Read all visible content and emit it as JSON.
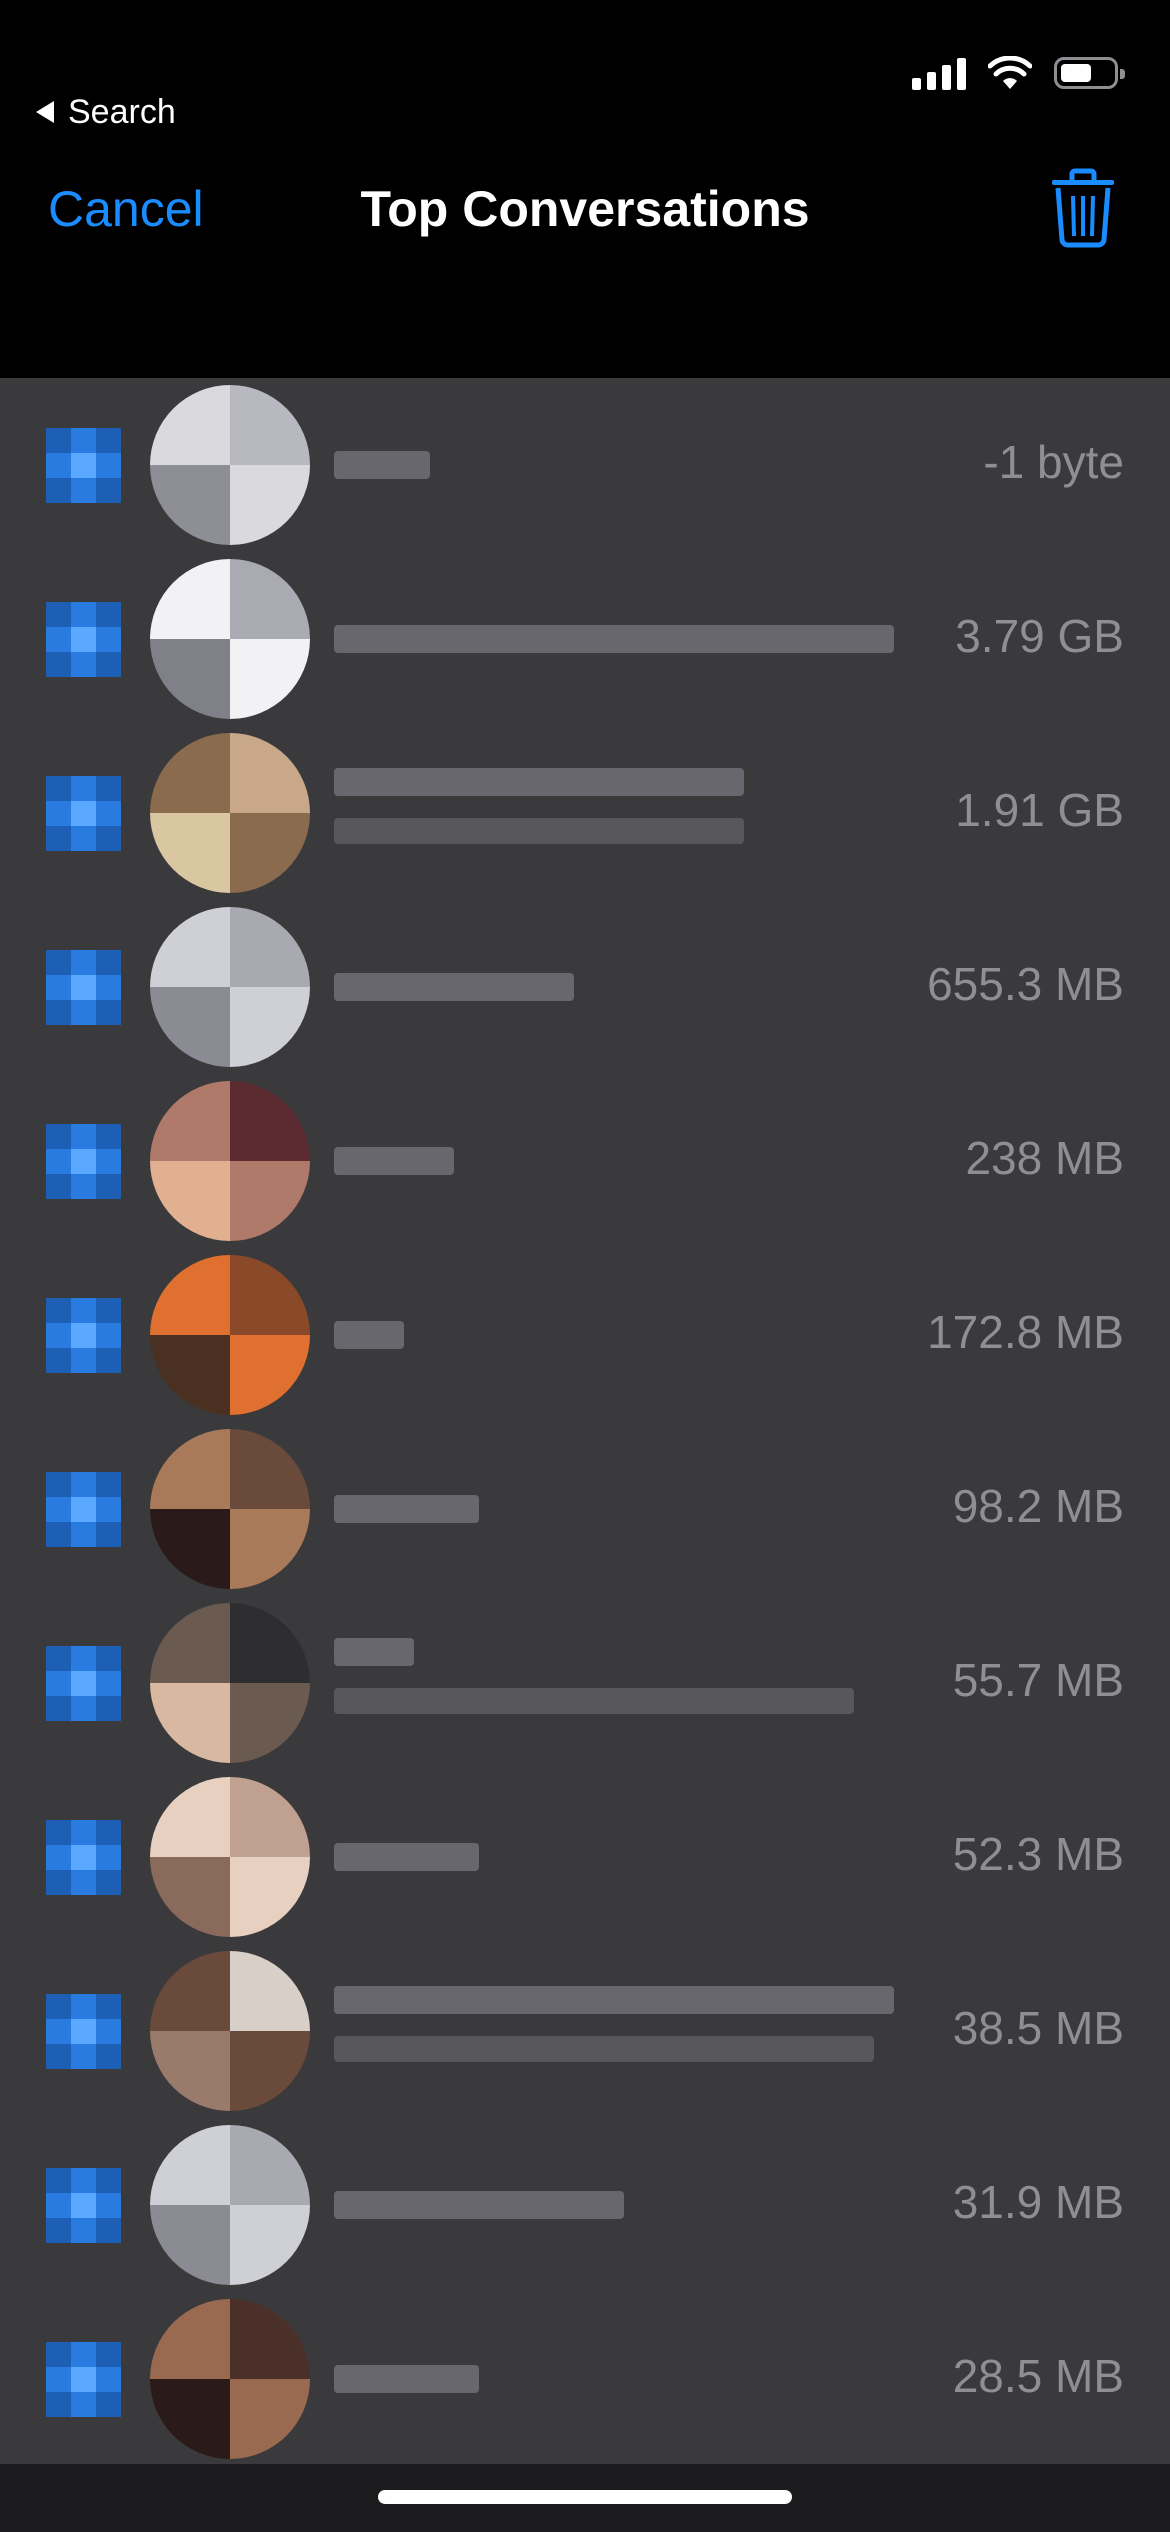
{
  "status_bar": {
    "back_app": "Search"
  },
  "nav": {
    "cancel": "Cancel",
    "title": "Top Conversations",
    "trash_icon": "trash-icon"
  },
  "colors": {
    "accent": "#1a8cff",
    "list_bg": "#3a3a3c",
    "size_text": "#8e8e93"
  },
  "conversations": [
    {
      "size": "-1 byte"
    },
    {
      "size": "3.79 GB"
    },
    {
      "size": "1.91 GB"
    },
    {
      "size": "655.3 MB"
    },
    {
      "size": "238 MB"
    },
    {
      "size": "172.8 MB"
    },
    {
      "size": "98.2 MB"
    },
    {
      "size": "55.7 MB"
    },
    {
      "size": "52.3 MB"
    },
    {
      "size": "38.5 MB"
    },
    {
      "size": "31.9 MB"
    },
    {
      "size": "28.5 MB"
    }
  ]
}
